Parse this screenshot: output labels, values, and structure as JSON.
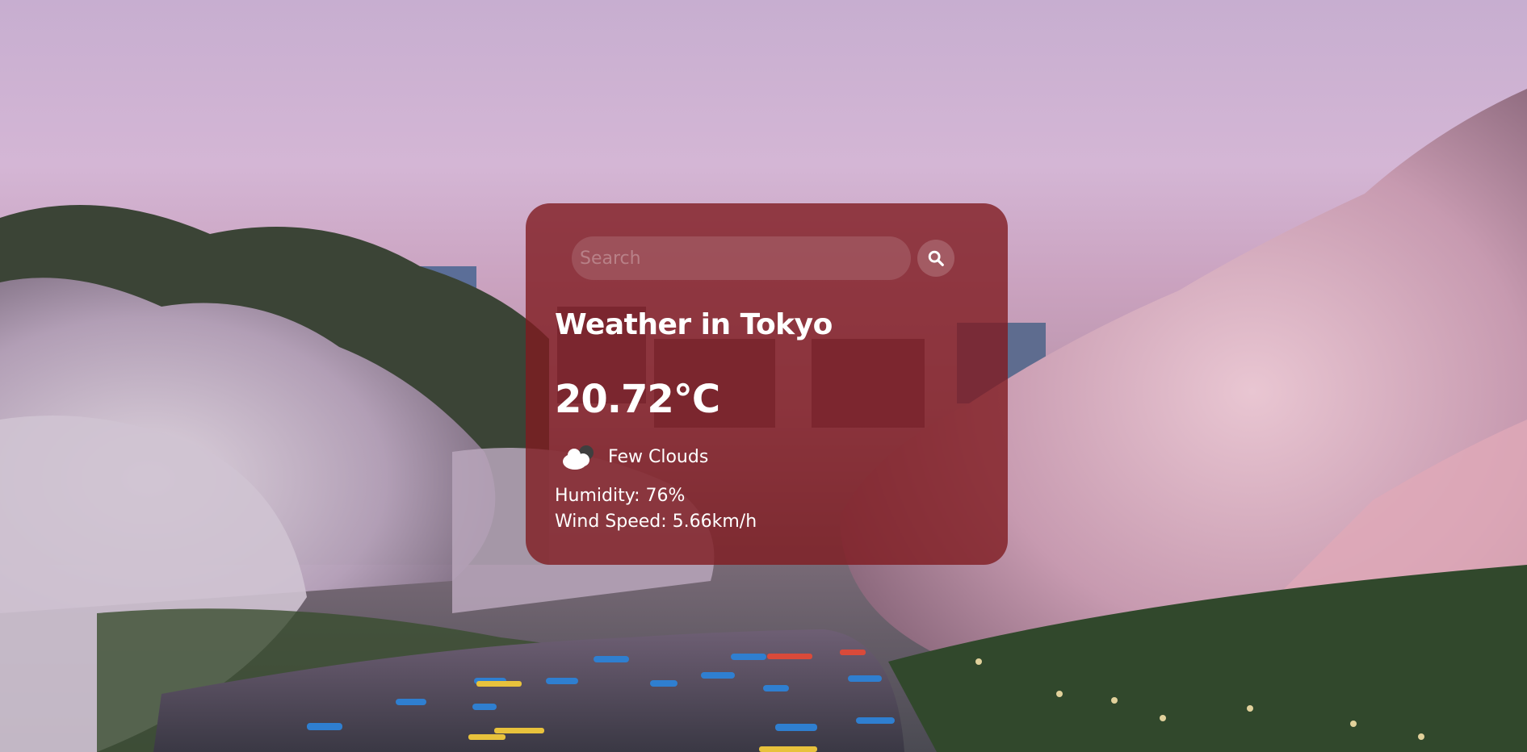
{
  "search": {
    "placeholder": "Search"
  },
  "weather": {
    "title": "Weather in Tokyo",
    "temperature": "20.72°C",
    "condition": "Few Clouds",
    "condition_icon": "few-clouds-icon",
    "humidity": "Humidity: 76%",
    "wind": "Wind Speed: 5.66km/h"
  },
  "colors": {
    "card_background": "#801c20",
    "text": "#ffffff"
  }
}
